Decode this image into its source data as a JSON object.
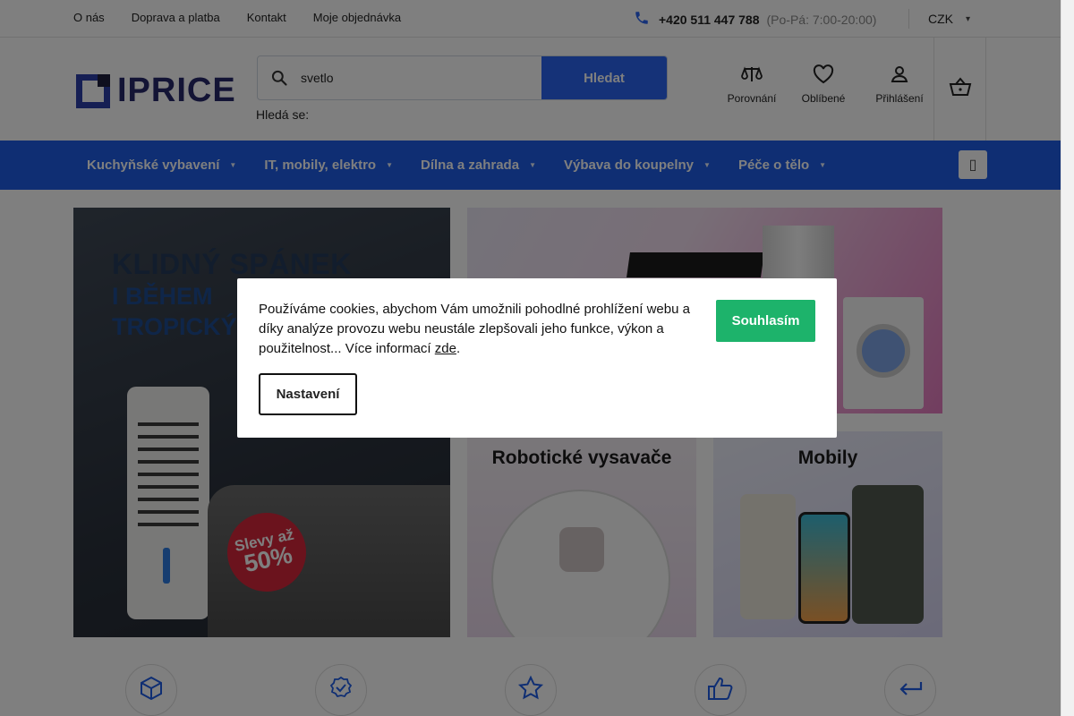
{
  "topbar": {
    "links": [
      "O nás",
      "Doprava a platba",
      "Kontakt",
      "Moje objednávka"
    ],
    "phone": "+420 511 447 788",
    "hours": "(Po-Pá: 7:00-20:00)",
    "currency": "CZK"
  },
  "header": {
    "logo_text": "IPRICE",
    "search_value": "svetlo",
    "search_button": "Hledat",
    "search_hint": "Hledá se:",
    "icons": {
      "compare": "Porovnání",
      "favorites": "Oblíbené",
      "login": "Přihlášení"
    }
  },
  "nav": {
    "items": [
      "Kuchyňské vybavení",
      "IT, mobily, elektro",
      "Dílna a zahrada",
      "Výbava do koupelny",
      "Péče o tělo"
    ]
  },
  "banners": {
    "main_line1": "KLIDNÝ SPÁNEK",
    "main_line2": "I BĚHEM",
    "main_line3": "TROPICKÝ",
    "badge_line1": "Slevy až",
    "badge_line2": "50%",
    "robot_title": "Robotické vysavače",
    "mobile_title": "Mobily"
  },
  "cookie": {
    "text": "Používáme cookies, abychom Vám umožnili pohodlné prohlížení webu a díky analýze provozu webu neustále zlepšovali jeho funkce, výkon a použitelnost... Více informací ",
    "link": "zde",
    "period": ".",
    "agree": "Souhlasím",
    "settings": "Nastavení"
  },
  "colors": {
    "primary": "#1e5de6",
    "agree": "#1db36b"
  }
}
